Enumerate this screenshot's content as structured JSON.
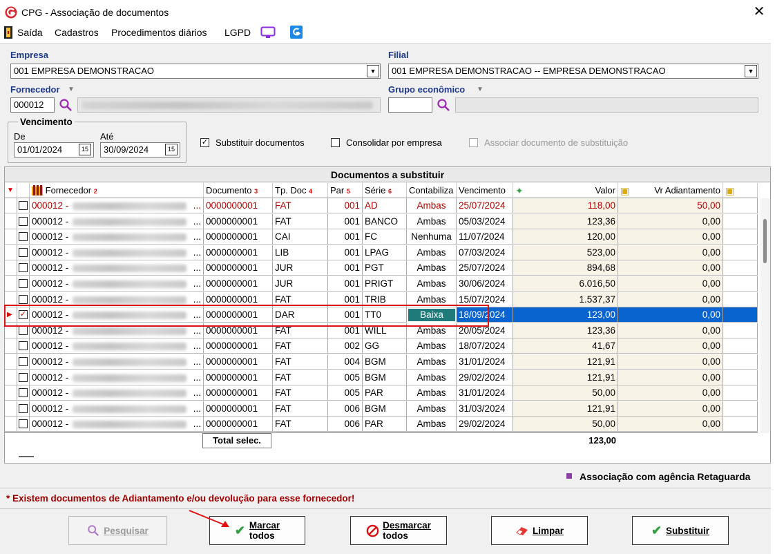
{
  "window": {
    "title": "CPG - Associação de documentos",
    "close": "✕"
  },
  "menu": [
    "Saída",
    "Cadastros",
    "Procedimentos diários",
    "LGPD"
  ],
  "filters": {
    "empresa_label": "Empresa",
    "empresa_value": "001 EMPRESA DEMONSTRACAO",
    "filial_label": "Filial",
    "filial_value": "001 EMPRESA DEMONSTRACAO -- EMPRESA DEMONSTRACAO",
    "fornecedor_label": "Fornecedor",
    "fornecedor_code": "000012",
    "grupo_label": "Grupo econômico",
    "vencimento_label": "Vencimento",
    "de_label": "De",
    "de_value": "01/01/2024",
    "ate_label": "Até",
    "ate_value": "30/09/2024",
    "cal_glyph": "15"
  },
  "options": {
    "substituir": {
      "label": "Substituir documentos",
      "checked": true
    },
    "consolidar": {
      "label": "Consolidar por empresa",
      "checked": false
    },
    "associar": {
      "label": "Associar documento de substituição",
      "checked": false,
      "enabled": false
    }
  },
  "grid": {
    "caption": "Documentos a substituir",
    "headers": {
      "fornecedor": "Fornecedor",
      "fornecedor_sort": "2",
      "documento": "Documento",
      "documento_sort": "3",
      "tpdoc": "Tp. Doc",
      "tpdoc_sort": "4",
      "par": "Par",
      "par_sort": "5",
      "serie": "Série",
      "serie_sort": "6",
      "contabiliza": "Contabiliza",
      "vencimento": "Vencimento",
      "valor": "Valor",
      "adiant": "Vr Adiantamento"
    },
    "rows": [
      {
        "checked": false,
        "forn": "000012 -",
        "doc": "0000000001",
        "tp": "FAT",
        "par": "001",
        "serie": "AD",
        "cont": "Ambas",
        "venc": "25/07/2024",
        "valor": "118,00",
        "adiant": "50,00",
        "red": true
      },
      {
        "checked": false,
        "forn": "000012 -",
        "doc": "0000000001",
        "tp": "FAT",
        "par": "001",
        "serie": "BANCO",
        "cont": "Ambas",
        "venc": "05/03/2024",
        "valor": "123,36",
        "adiant": "0,00"
      },
      {
        "checked": false,
        "forn": "000012 -",
        "doc": "0000000001",
        "tp": "CAI",
        "par": "001",
        "serie": "FC",
        "cont": "Nenhuma",
        "venc": "11/07/2024",
        "valor": "120,00",
        "adiant": "0,00"
      },
      {
        "checked": false,
        "forn": "000012 -",
        "doc": "0000000001",
        "tp": "LIB",
        "par": "001",
        "serie": "LPAG",
        "cont": "Ambas",
        "venc": "07/03/2024",
        "valor": "523,00",
        "adiant": "0,00"
      },
      {
        "checked": false,
        "forn": "000012 -",
        "doc": "0000000001",
        "tp": "JUR",
        "par": "001",
        "serie": "PGT",
        "cont": "Ambas",
        "venc": "25/07/2024",
        "valor": "894,68",
        "adiant": "0,00"
      },
      {
        "checked": false,
        "forn": "000012 -",
        "doc": "0000000001",
        "tp": "JUR",
        "par": "001",
        "serie": "PRIGT",
        "cont": "Ambas",
        "venc": "30/06/2024",
        "valor": "6.016,50",
        "adiant": "0,00"
      },
      {
        "checked": false,
        "forn": "000012 -",
        "doc": "0000000001",
        "tp": "FAT",
        "par": "001",
        "serie": "TRIB",
        "cont": "Ambas",
        "venc": "15/07/2024",
        "valor": "1.537,37",
        "adiant": "0,00"
      },
      {
        "checked": true,
        "forn": "000012 -",
        "doc": "0000000001",
        "tp": "DAR",
        "par": "001",
        "serie": "TT0",
        "cont": "Baixa",
        "venc": "18/09/2024",
        "valor": "123,00",
        "adiant": "0,00",
        "selected": true
      },
      {
        "checked": false,
        "forn": "000012 -",
        "doc": "0000000001",
        "tp": "FAT",
        "par": "001",
        "serie": "WILL",
        "cont": "Ambas",
        "venc": "20/05/2024",
        "valor": "123,36",
        "adiant": "0,00"
      },
      {
        "checked": false,
        "forn": "000012 -",
        "doc": "0000000001",
        "tp": "FAT",
        "par": "002",
        "serie": "GG",
        "cont": "Ambas",
        "venc": "18/07/2024",
        "valor": "41,67",
        "adiant": "0,00"
      },
      {
        "checked": false,
        "forn": "000012 -",
        "doc": "0000000001",
        "tp": "FAT",
        "par": "004",
        "serie": "BGM",
        "cont": "Ambas",
        "venc": "31/01/2024",
        "valor": "121,91",
        "adiant": "0,00"
      },
      {
        "checked": false,
        "forn": "000012 -",
        "doc": "0000000001",
        "tp": "FAT",
        "par": "005",
        "serie": "BGM",
        "cont": "Ambas",
        "venc": "29/02/2024",
        "valor": "121,91",
        "adiant": "0,00"
      },
      {
        "checked": false,
        "forn": "000012 -",
        "doc": "0000000001",
        "tp": "FAT",
        "par": "005",
        "serie": "PAR",
        "cont": "Ambas",
        "venc": "31/01/2024",
        "valor": "50,00",
        "adiant": "0,00"
      },
      {
        "checked": false,
        "forn": "000012 -",
        "doc": "0000000001",
        "tp": "FAT",
        "par": "006",
        "serie": "BGM",
        "cont": "Ambas",
        "venc": "31/03/2024",
        "valor": "121,91",
        "adiant": "0,00"
      },
      {
        "checked": false,
        "forn": "000012 -",
        "doc": "0000000001",
        "tp": "FAT",
        "par": "006",
        "serie": "PAR",
        "cont": "Ambas",
        "venc": "29/02/2024",
        "valor": "50,00",
        "adiant": "0,00"
      }
    ],
    "footer_label": "Total selec.",
    "footer_total": "123,00",
    "ellipsis": "..."
  },
  "legend": {
    "text": "Associação com agência Retaguarda",
    "color": "#8b3fa3"
  },
  "warning": "* Existem documentos de Adiantamento e/ou devolução para esse fornecedor!",
  "buttons": {
    "pesquisar": "Pesquisar",
    "marcar_1": "Marcar",
    "marcar_2": "todos",
    "desmarcar_1": "Desmarcar",
    "desmarcar_2": "todos",
    "limpar": "Limpar",
    "substituir": "Substituir"
  },
  "colors": {
    "selection": "#0a64d0",
    "highlight_box": "#d11",
    "label_blue": "#1e3a8a",
    "warning_red": "#a00000"
  }
}
